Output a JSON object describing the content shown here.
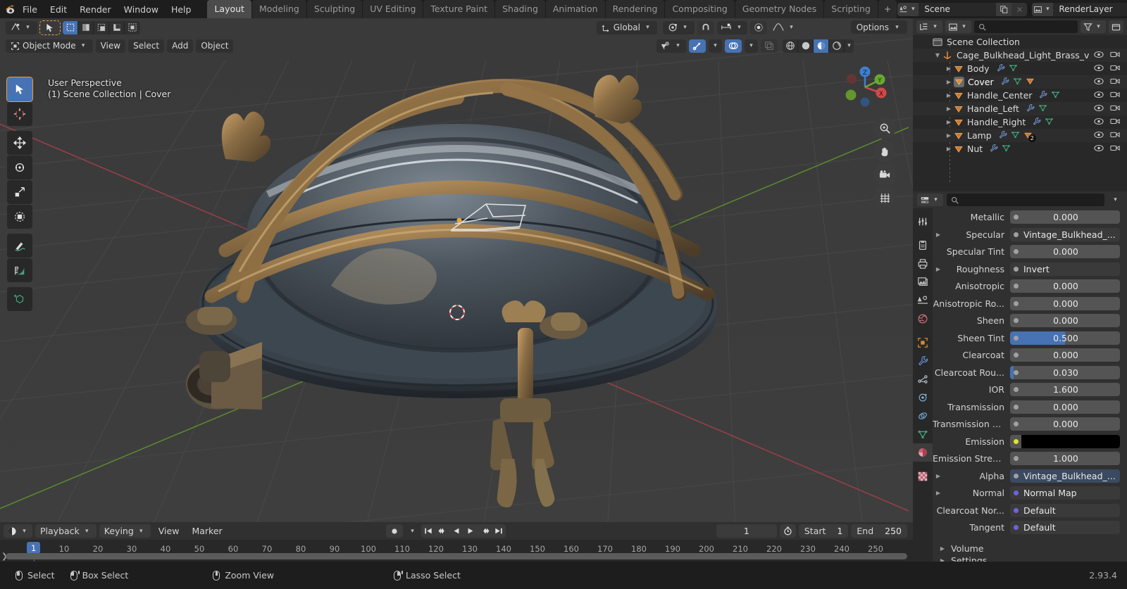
{
  "app": {
    "version": "2.93.4"
  },
  "topbar": {
    "logo_icon": "blender-logo-icon",
    "menus": [
      "File",
      "Edit",
      "Render",
      "Window",
      "Help"
    ],
    "workspace_tabs": [
      {
        "label": "Layout",
        "active": true
      },
      {
        "label": "Modeling",
        "active": false
      },
      {
        "label": "Sculpting",
        "active": false
      },
      {
        "label": "UV Editing",
        "active": false
      },
      {
        "label": "Texture Paint",
        "active": false
      },
      {
        "label": "Shading",
        "active": false
      },
      {
        "label": "Animation",
        "active": false
      },
      {
        "label": "Rendering",
        "active": false
      },
      {
        "label": "Compositing",
        "active": false
      },
      {
        "label": "Geometry Nodes",
        "active": false
      },
      {
        "label": "Scripting",
        "active": false
      }
    ],
    "add_workspace_label": "+",
    "scene": {
      "icon": "scene-icon",
      "name": "Scene",
      "new_icon": "duplicate-icon",
      "unlink_icon": "close-icon"
    },
    "viewlayer": {
      "icon": "view-layer-icon",
      "name": "RenderLayer",
      "new_icon": "duplicate-icon",
      "remove_icon": "close-icon"
    }
  },
  "viewport": {
    "editor_type_icon": "editor-type-3dview-icon",
    "cursor_tool_icon": "tweak-cursor-icon",
    "select_modes": [
      "set-select-icon",
      "extend-select-icon",
      "subtract-select-icon",
      "invert-select-icon",
      "intersect-select-icon"
    ],
    "mode_selector": {
      "icon": "object-mode-icon",
      "label": "Object Mode"
    },
    "menus": [
      "View",
      "Select",
      "Add",
      "Object"
    ],
    "transform_orientation": {
      "icon": "orientation-icon",
      "label": "Global"
    },
    "pivot_icon": "pivot-point-icon",
    "snap_magnet_icon": "snap-magnet-icon",
    "snap_to_icon": "snap-increment-icon",
    "proportional_icon": "proportional-edit-icon",
    "falloff_icon": "smooth-falloff-icon",
    "visibility_icon": "visibility-selector-icon",
    "gizmo_icon": "gizmo-icon",
    "overlays_icon": "overlays-icon",
    "xray_icon": "xray-icon",
    "shading_modes": [
      "wireframe-icon",
      "solid-icon",
      "material-preview-icon",
      "rendered-icon"
    ],
    "shading_active_index": 2,
    "options_label": "Options",
    "overlay_text_line1": "User Perspective",
    "overlay_text_line2": "(1) Scene Collection | Cover",
    "toolbar": [
      {
        "name": "tweak-tool",
        "active": true
      },
      {
        "name": "cursor-tool",
        "active": false
      },
      {
        "name": "move-tool",
        "active": false
      },
      {
        "name": "rotate-tool",
        "active": false
      },
      {
        "name": "scale-tool",
        "active": false
      },
      {
        "name": "transform-tool",
        "active": false
      },
      {
        "name": "annotate-tool",
        "active": false
      },
      {
        "name": "measure-tool",
        "active": false
      },
      {
        "name": "add-cube-tool",
        "active": false
      }
    ],
    "gizmo_axes": [
      "Z",
      "Y",
      "X"
    ],
    "nav_buttons": [
      "zoom-icon",
      "pan-hand-icon",
      "camera-view-icon",
      "toggle-ortho-icon"
    ]
  },
  "outliner": {
    "display_mode_icon": "outliner-display-mode-icon",
    "filter_icon": "filter-icon",
    "new_collection_icon": "new-collection-icon",
    "search_placeholder": "",
    "search_value": "",
    "rows": [
      {
        "indent": 0,
        "label": "Scene Collection",
        "icon": "collection-icon",
        "tri": "",
        "selected": false,
        "data_icons": []
      },
      {
        "indent": 1,
        "label": "Cage_Bulkhead_Light_Brass_v",
        "icon": "empty-axes-icon",
        "tri": "down",
        "selected": false,
        "data_icons": []
      },
      {
        "indent": 2,
        "label": "Body",
        "icon": "mesh-object-icon",
        "tri": "right",
        "selected": false,
        "data_icons": [
          "modifier-icon",
          "mesh-data-icon"
        ]
      },
      {
        "indent": 2,
        "label": "Cover",
        "icon": "mesh-object-icon",
        "tri": "right",
        "selected": true,
        "data_icons": [
          "modifier-icon",
          "mesh-data-icon",
          "object-icon"
        ]
      },
      {
        "indent": 2,
        "label": "Handle_Center",
        "icon": "mesh-object-icon",
        "tri": "right",
        "selected": false,
        "data_icons": [
          "modifier-icon",
          "mesh-data-icon"
        ]
      },
      {
        "indent": 2,
        "label": "Handle_Left",
        "icon": "mesh-object-icon",
        "tri": "right",
        "selected": false,
        "data_icons": [
          "modifier-icon",
          "mesh-data-icon"
        ]
      },
      {
        "indent": 2,
        "label": "Handle_Right",
        "icon": "mesh-object-icon",
        "tri": "right",
        "selected": false,
        "data_icons": [
          "modifier-icon",
          "mesh-data-icon"
        ]
      },
      {
        "indent": 2,
        "label": "Lamp",
        "icon": "mesh-object-icon",
        "tri": "right",
        "selected": false,
        "data_icons": [
          "modifier-icon",
          "mesh-data-icon",
          "object-icon"
        ],
        "badge": "2"
      },
      {
        "indent": 2,
        "label": "Nut",
        "icon": "mesh-object-icon",
        "tri": "right",
        "selected": false,
        "data_icons": [
          "modifier-icon",
          "mesh-data-icon"
        ]
      }
    ],
    "row_toggles": [
      "eye-icon",
      "camera-icon"
    ]
  },
  "properties": {
    "editor_icon": "properties-editor-icon",
    "search_placeholder": "",
    "tabs": [
      {
        "name": "tool-tab",
        "icon": "tool-icon",
        "active": false
      },
      {
        "name": "render-tab",
        "icon": "render-icon",
        "active": false
      },
      {
        "name": "output-tab",
        "icon": "output-printer-icon",
        "active": false
      },
      {
        "name": "view-layer-tab",
        "icon": "view-layer-images-icon",
        "active": false
      },
      {
        "name": "scene-tab",
        "icon": "scene-cone-icon",
        "active": false
      },
      {
        "name": "world-tab",
        "icon": "world-globe-icon",
        "active": false
      },
      {
        "name": "object-tab",
        "icon": "object-square-icon",
        "active": false
      },
      {
        "name": "modifier-tab",
        "icon": "wrench-icon",
        "active": false
      },
      {
        "name": "particles-tab",
        "icon": "particles-icon",
        "active": false
      },
      {
        "name": "physics-tab",
        "icon": "physics-orbit-icon",
        "active": false
      },
      {
        "name": "constraints-tab",
        "icon": "constraints-icon",
        "active": false
      },
      {
        "name": "data-tab",
        "icon": "mesh-data-triangle-icon",
        "active": false
      },
      {
        "name": "material-tab",
        "icon": "material-sphere-icon",
        "active": true
      },
      {
        "name": "texture-tab",
        "icon": "texture-checker-icon",
        "active": false
      }
    ],
    "rows": [
      {
        "label": "Metallic",
        "tri": false,
        "type": "value",
        "value": "0.000",
        "fill": 0
      },
      {
        "label": "Specular",
        "tri": true,
        "type": "link",
        "value": "Vintage_Bulkhead_...",
        "socket": "gray"
      },
      {
        "label": "Specular Tint",
        "tri": false,
        "type": "value",
        "value": "0.000",
        "fill": 0
      },
      {
        "label": "Roughness",
        "tri": true,
        "type": "link",
        "value": "Invert",
        "socket": "gray"
      },
      {
        "label": "Anisotropic",
        "tri": false,
        "type": "value",
        "value": "0.000",
        "fill": 0
      },
      {
        "label": "Anisotropic Ro...",
        "tri": false,
        "type": "value",
        "value": "0.000",
        "fill": 0
      },
      {
        "label": "Sheen",
        "tri": false,
        "type": "value",
        "value": "0.000",
        "fill": 0
      },
      {
        "label": "Sheen Tint",
        "tri": false,
        "type": "value",
        "value": "0.500",
        "fill": 50
      },
      {
        "label": "Clearcoat",
        "tri": false,
        "type": "value",
        "value": "0.000",
        "fill": 0
      },
      {
        "label": "Clearcoat Rou...",
        "tri": false,
        "type": "value",
        "value": "0.030",
        "fill": 3
      },
      {
        "label": "IOR",
        "tri": false,
        "type": "value",
        "value": "1.600",
        "fill": 0
      },
      {
        "label": "Transmission",
        "tri": false,
        "type": "value",
        "value": "0.000",
        "fill": 0
      },
      {
        "label": "Transmission R...",
        "tri": false,
        "type": "value",
        "value": "0.000",
        "fill": 0
      },
      {
        "label": "Emission",
        "tri": false,
        "type": "color",
        "value": "",
        "color": "#000000",
        "socket": "yellow"
      },
      {
        "label": "Emission Stren...",
        "tri": false,
        "type": "value",
        "value": "1.000",
        "fill": 0
      },
      {
        "label": "Alpha",
        "tri": true,
        "type": "linksel",
        "value": "Vintage_Bulkhead_...",
        "socket": "gray"
      },
      {
        "label": "Normal",
        "tri": true,
        "type": "link",
        "value": "Normal Map",
        "socket": "purple"
      },
      {
        "label": "Clearcoat Nor...",
        "tri": false,
        "type": "link",
        "value": "Default",
        "socket": "purple"
      },
      {
        "label": "Tangent",
        "tri": false,
        "type": "link",
        "value": "Default",
        "socket": "purple"
      }
    ],
    "sections": [
      {
        "label": "Volume"
      },
      {
        "label": "Settings"
      }
    ]
  },
  "timeline": {
    "editor_icon": "timeline-editor-icon",
    "menus": [
      {
        "label": "Playback",
        "dropdown": true
      },
      {
        "label": "Keying",
        "dropdown": true
      },
      {
        "label": "View",
        "dropdown": false
      },
      {
        "label": "Marker",
        "dropdown": false
      }
    ],
    "autokey_icon": "record-icon",
    "playback_buttons": [
      "jump-start-icon",
      "prev-keyframe-icon",
      "play-reverse-icon",
      "play-icon",
      "next-keyframe-icon",
      "jump-end-icon"
    ],
    "current_frame": "1",
    "timer_icon": "use-preview-range-icon",
    "start_label": "Start",
    "start_value": "1",
    "end_label": "End",
    "end_value": "250",
    "ticks": [
      "1",
      "10",
      "20",
      "30",
      "40",
      "50",
      "60",
      "70",
      "80",
      "90",
      "100",
      "110",
      "120",
      "130",
      "140",
      "150",
      "160",
      "170",
      "180",
      "190",
      "200",
      "210",
      "220",
      "230",
      "240",
      "250"
    ],
    "playhead_label": "1"
  },
  "status": {
    "items": [
      {
        "icon": "mouse-left-icon",
        "label": "Select"
      },
      {
        "icon": "mouse-left-drag-icon",
        "label": "Box Select"
      },
      {
        "icon": "mouse-middle-icon",
        "label": "Zoom View"
      },
      {
        "icon": "mouse-right-drag-icon",
        "label": "Lasso Select"
      }
    ],
    "version": "2.93.4"
  },
  "colors": {
    "accent_blue": "#4772b3",
    "object_orange": "#e8a33d",
    "mesh_green": "#3fa37a",
    "modifier_blue": "#6d90c9"
  }
}
